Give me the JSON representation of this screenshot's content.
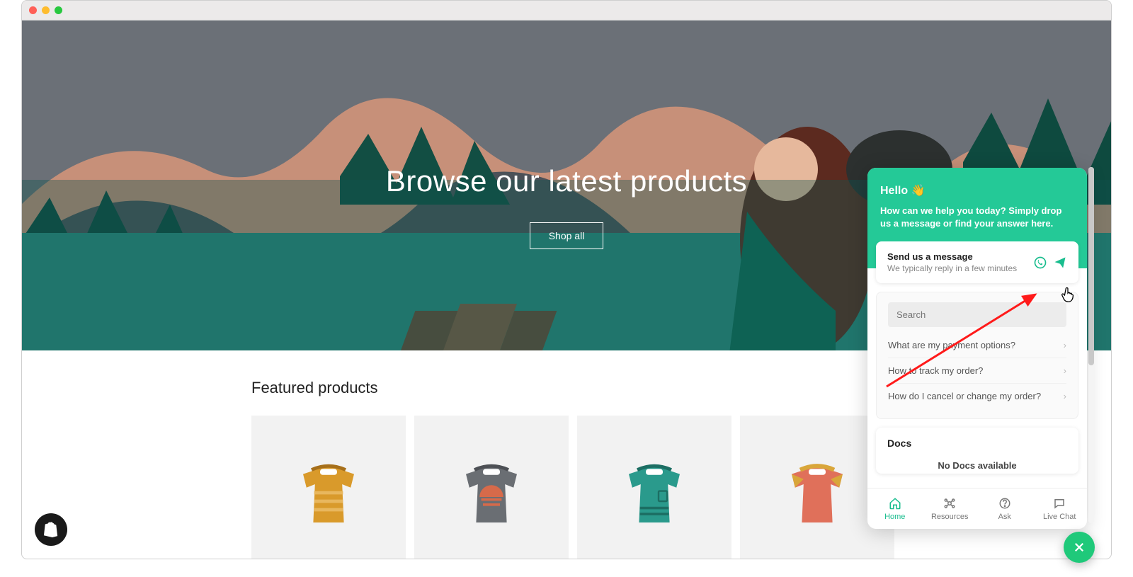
{
  "hero": {
    "title": "Browse our latest products",
    "cta": "Shop all"
  },
  "featured": {
    "heading": "Featured products"
  },
  "chat": {
    "greeting": "Hello",
    "greeting_emoji": "👋",
    "subtext": "How can we help you today? Simply drop us a message or find your answer here.",
    "send": {
      "title": "Send us a message",
      "subtitle": "We typically reply in a few minutes"
    },
    "search_placeholder": "Search",
    "faq": [
      "What are my payment options?",
      "How to track my order?",
      "How do I cancel or change my order?"
    ],
    "docs": {
      "title": "Docs",
      "empty": "No Docs available"
    },
    "tabs": {
      "home": "Home",
      "resources": "Resources",
      "ask": "Ask",
      "livechat": "Live Chat"
    }
  },
  "colors": {
    "accent": "#24c997",
    "fab": "#1fc97a"
  }
}
